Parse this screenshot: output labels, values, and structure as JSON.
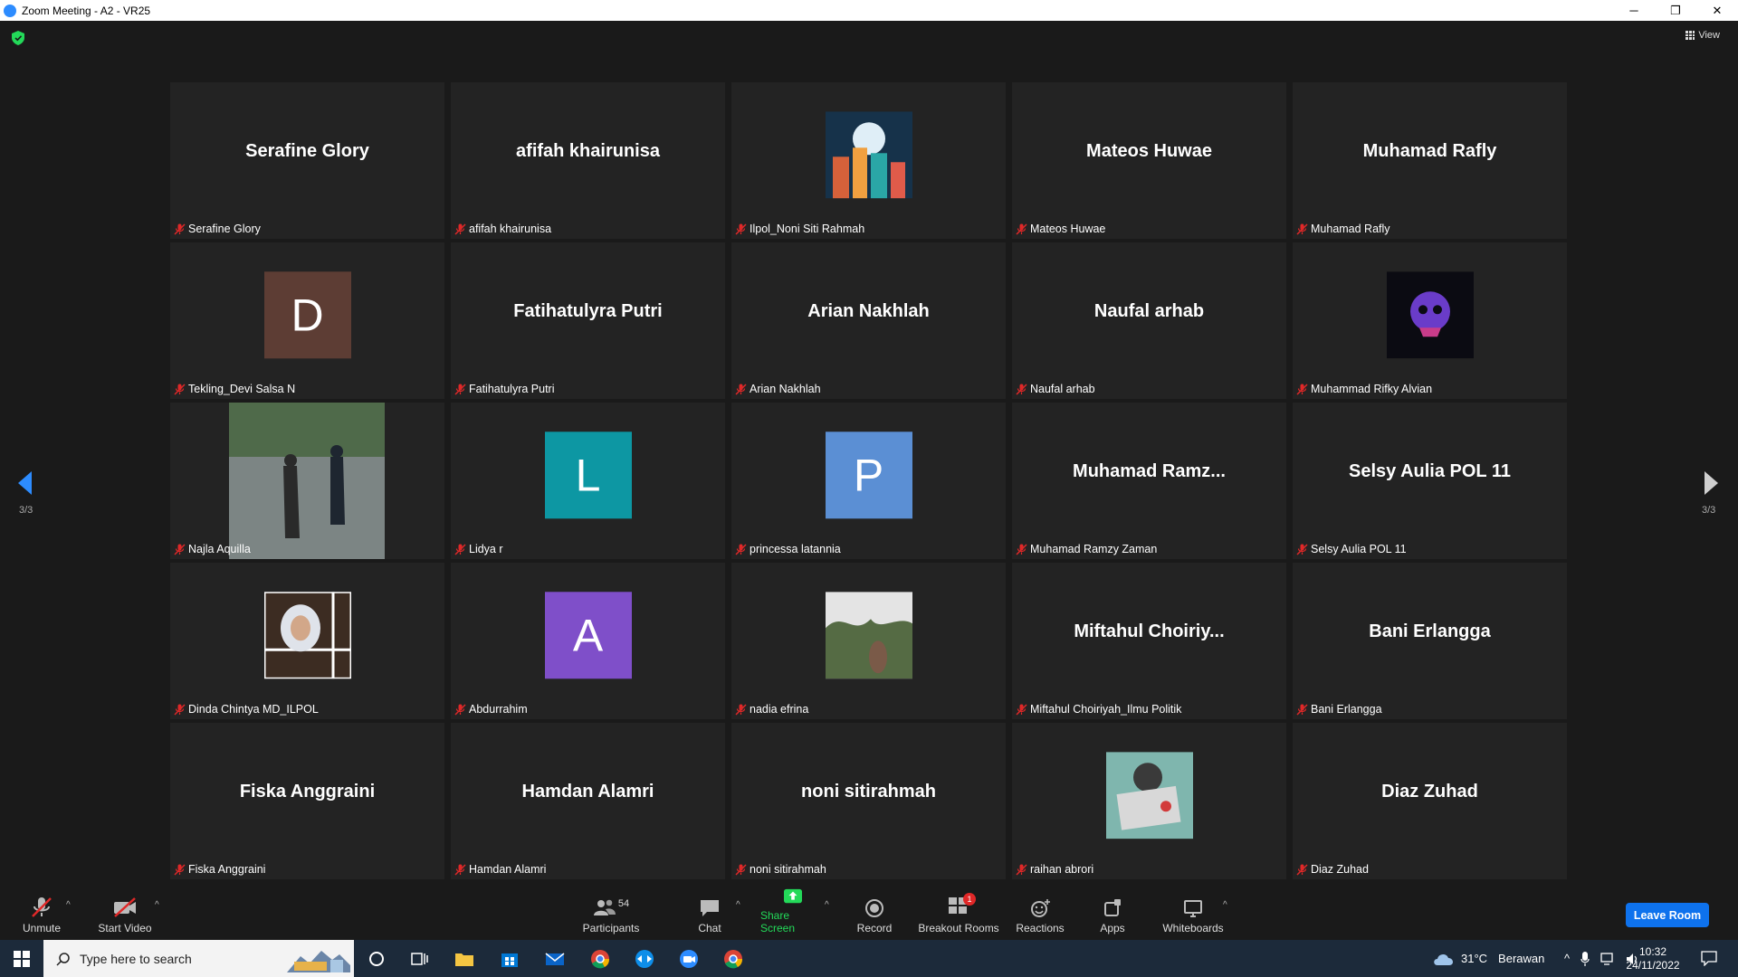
{
  "window": {
    "title": "Zoom Meeting - A2 - VR25",
    "minimize": "─",
    "restore": "❐",
    "close": "✕"
  },
  "view_button": "View",
  "page_indicator_left": "3/3",
  "page_indicator_right": "3/3",
  "participants": [
    {
      "big": "Serafine Glory",
      "label": "Serafine Glory",
      "kind": "name"
    },
    {
      "big": "afifah khairunisa",
      "label": "afifah khairunisa",
      "kind": "name"
    },
    {
      "big": "",
      "label": "Ilpol_Noni Siti Rahmah",
      "kind": "photo-city"
    },
    {
      "big": "Mateos Huwae",
      "label": "Mateos Huwae",
      "kind": "name"
    },
    {
      "big": "Muhamad Rafly",
      "label": "Muhamad Rafly",
      "kind": "name"
    },
    {
      "big": "D",
      "label": "Tekling_Devi Salsa N",
      "kind": "letter",
      "color": "#5d3d34"
    },
    {
      "big": "Fatihatulyra Putri",
      "label": "Fatihatulyra Putri",
      "kind": "name"
    },
    {
      "big": "Arian Nakhlah",
      "label": "Arian Nakhlah",
      "kind": "name"
    },
    {
      "big": "Naufal arhab",
      "label": "Naufal arhab",
      "kind": "name"
    },
    {
      "big": "",
      "label": "Muhammad Rifky Alvian",
      "kind": "photo-skull"
    },
    {
      "big": "",
      "label": "Najla Aquilla",
      "kind": "photo-rain"
    },
    {
      "big": "L",
      "label": "Lidya r",
      "kind": "letter",
      "color": "#0d97a3"
    },
    {
      "big": "P",
      "label": "princessa latannia",
      "kind": "letter",
      "color": "#5b8fd4"
    },
    {
      "big": "Muhamad  Ramz...",
      "label": "Muhamad Ramzy Zaman",
      "kind": "name"
    },
    {
      "big": "Selsy Aulia POL 11",
      "label": "Selsy Aulia POL 11",
      "kind": "name"
    },
    {
      "big": "",
      "label": "Dinda Chintya MD_ILPOL",
      "kind": "photo-hijab"
    },
    {
      "big": "A",
      "label": "Abdurrahim",
      "kind": "letter",
      "color": "#7f4fc9"
    },
    {
      "big": "",
      "label": "nadia efrina",
      "kind": "photo-plant"
    },
    {
      "big": "Miftahul  Choiriy...",
      "label": "Miftahul Choiriyah_Ilmu Politik",
      "kind": "name"
    },
    {
      "big": "Bani Erlangga",
      "label": "Bani Erlangga",
      "kind": "name"
    },
    {
      "big": "Fiska Anggraini",
      "label": "Fiska Anggraini",
      "kind": "name"
    },
    {
      "big": "Hamdan Alamri",
      "label": "Hamdan Alamri",
      "kind": "name"
    },
    {
      "big": "noni sitirahmah",
      "label": "noni sitirahmah",
      "kind": "name"
    },
    {
      "big": "",
      "label": "raihan abrori",
      "kind": "photo-sign"
    },
    {
      "big": "Diaz Zuhad",
      "label": "Diaz Zuhad",
      "kind": "name"
    }
  ],
  "toolbar": {
    "unmute": "Unmute",
    "start_video": "Start Video",
    "participants": "Participants",
    "participants_count": "54",
    "chat": "Chat",
    "share_screen": "Share Screen",
    "record": "Record",
    "breakout_rooms": "Breakout Rooms",
    "breakout_badge": "1",
    "reactions": "Reactions",
    "apps": "Apps",
    "whiteboards": "Whiteboards",
    "leave": "Leave Room"
  },
  "taskbar": {
    "search_placeholder": "Type here to search",
    "weather_temp": "31°C",
    "weather_desc": "Berawan",
    "time": "10:32",
    "date": "24/11/2022"
  },
  "colors": {
    "accent": "#0e72ed",
    "share_green": "#23d959",
    "mute_red": "#e02828"
  }
}
